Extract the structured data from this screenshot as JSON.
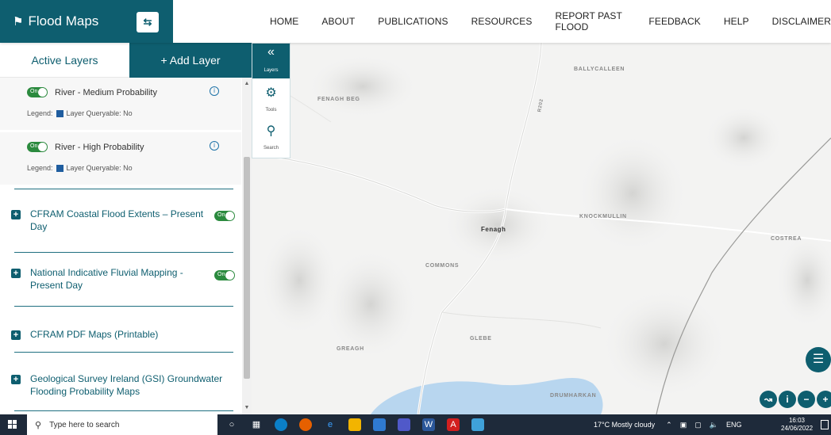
{
  "header": {
    "app_title": "Flood Maps",
    "nav": [
      "HOME",
      "ABOUT",
      "PUBLICATIONS",
      "RESOURCES",
      "REPORT PAST FLOOD",
      "FEEDBACK",
      "HELP",
      "DISCLAIMER"
    ]
  },
  "sidebar": {
    "tab_active": "Active Layers",
    "tab_add": "+ Add Layer",
    "sublayers": [
      {
        "toggle": "On",
        "name": "River - Medium Probability",
        "legend_label": "Legend:",
        "queryable": "Layer Queryable: No"
      },
      {
        "toggle": "On",
        "name": "River - High Probability",
        "legend_label": "Legend:",
        "queryable": "Layer Queryable: No"
      }
    ],
    "groups": [
      {
        "name": "CFRAM Coastal Flood Extents – Present Day",
        "toggle": "On"
      },
      {
        "name": "National Indicative Fluvial Mapping - Present Day",
        "toggle": "On"
      },
      {
        "name": "CFRAM PDF Maps (Printable)"
      },
      {
        "name": "Geological Survey Ireland (GSI) Groundwater Flooding Probability Maps"
      }
    ]
  },
  "tools_panel": {
    "layers_label": "Layers",
    "tools_label": "Tools",
    "search_label": "Search"
  },
  "map": {
    "labels": {
      "ballycalleen": "BALLYCALLEEN",
      "fenagh_beg": "FENAGH BEG",
      "fenagh": "Fenagh",
      "knockmullin": "KNOCKMULLIN",
      "costrea": "COSTREA",
      "commons": "COMMONS",
      "glebe": "GLEBE",
      "greagh": "GREAGH",
      "drumharkan": "DRUMHARKAN",
      "road": "R202"
    },
    "colors": {
      "water": "#b8d6ef",
      "background": "#f3f3f2",
      "accent": "#0e5e6f"
    }
  },
  "taskbar": {
    "search_placeholder": "Type here to search",
    "weather": "17°C  Mostly cloudy",
    "language": "ENG",
    "time": "16:03",
    "date": "24/06/2022"
  }
}
